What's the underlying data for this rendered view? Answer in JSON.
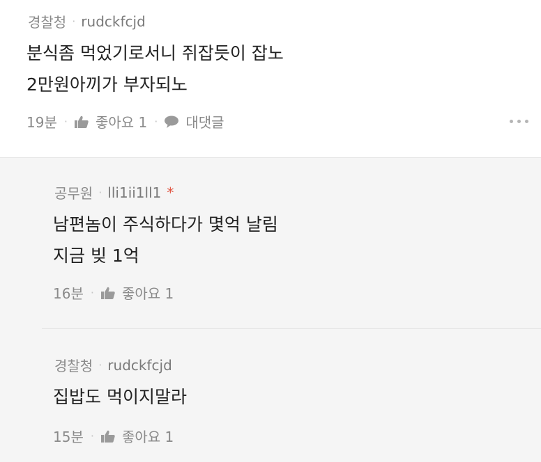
{
  "comment": {
    "badge": "경찰청",
    "username": "rudckfcjd",
    "lines": [
      "분식좀 먹었기로서니 쥐잡듯이 잡노",
      "2만원아끼가 부자되노"
    ],
    "time": "19분",
    "like_label": "좋아요 1",
    "reply_label": "대댓글"
  },
  "replies": [
    {
      "badge": "공무원",
      "username": "lli1ii1ll1",
      "mark": "*",
      "lines": [
        "남편놈이 주식하다가 몇억 날림",
        "지금 빚 1억"
      ],
      "time": "16분",
      "like_label": "좋아요 1"
    },
    {
      "badge": "경찰청",
      "username": "rudckfcjd",
      "lines": [
        "집밥도 먹이지말라"
      ],
      "time": "15분",
      "like_label": "좋아요 1"
    }
  ],
  "colors": {
    "meta": "#8a8a8a",
    "body": "#222222",
    "reply_bg": "#f5f5f5",
    "mark": "#e0523f"
  },
  "icons": [
    "thumbs-up-icon",
    "speech-bubble-icon",
    "more-dots-icon"
  ]
}
